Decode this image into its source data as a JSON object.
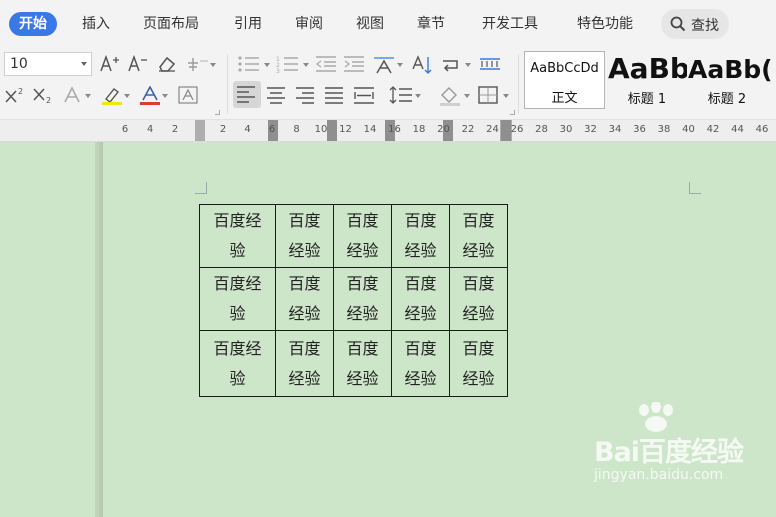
{
  "menu": {
    "tabs": [
      "开始",
      "插入",
      "页面布局",
      "引用",
      "审阅",
      "视图",
      "章节",
      "开发工具",
      "特色功能"
    ],
    "active_tab": "开始",
    "search_label": "查找"
  },
  "ribbon": {
    "font_size": "10",
    "styles": [
      {
        "sample": "AaBbCcDd",
        "name": "正文"
      },
      {
        "sample": "AaBb",
        "name": "标题 1"
      },
      {
        "sample": "AaBb(",
        "name": "标题 2"
      }
    ]
  },
  "ruler": {
    "left_marks": [
      "6",
      "4",
      "2"
    ],
    "right_marks": [
      "2",
      "4",
      "6",
      "8",
      "10",
      "12",
      "14",
      "16",
      "18",
      "20",
      "22",
      "24",
      "26",
      "28",
      "30",
      "32",
      "34",
      "36",
      "38",
      "40",
      "42",
      "44",
      "46"
    ]
  },
  "table": {
    "rows": [
      [
        "百度经验",
        "百度经验",
        "百度经验",
        "百度经验",
        "百度经验"
      ],
      [
        "百度经验",
        "百度经验",
        "百度经验",
        "百度经验",
        "百度经验"
      ],
      [
        "百度经验",
        "百度经验",
        "百度经验",
        "百度经验",
        "百度经验"
      ]
    ]
  },
  "watermark": {
    "brand": "Bai百度经验",
    "url": "jingyan.baidu.com"
  },
  "colors": {
    "accent": "#3a78e6",
    "page_background": "#cde5c9",
    "highlight": "#f5e50f",
    "font_color": "#e03b2e"
  }
}
